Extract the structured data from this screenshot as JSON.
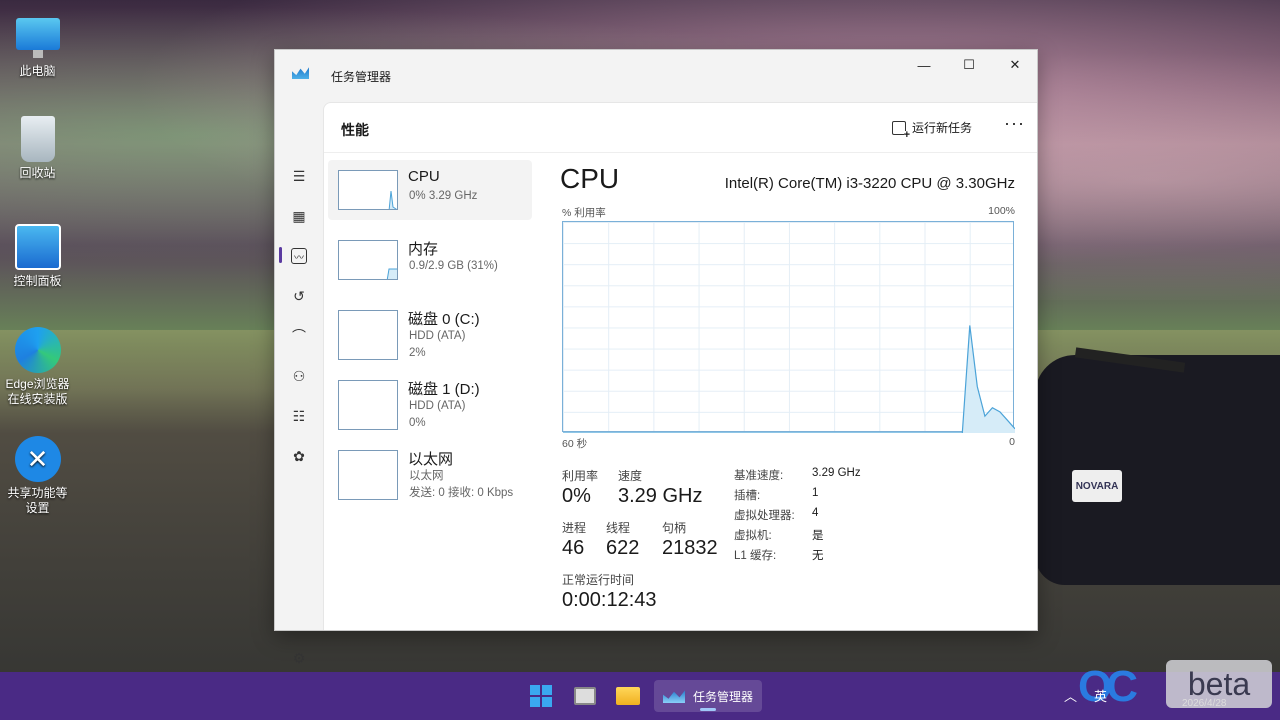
{
  "desktop": {
    "icons": [
      {
        "label": "此电脑"
      },
      {
        "label": "回收站"
      },
      {
        "label": "控制面板"
      },
      {
        "label": "Edge浏览器\n在线安装版",
        "l1": "Edge浏览器",
        "l2": "在线安装版"
      },
      {
        "l1": "共享功能等",
        "l2": "设置"
      }
    ]
  },
  "window": {
    "title": "任务管理器",
    "controls": {
      "minimize": "—",
      "maximize": "☐",
      "close": "✕"
    }
  },
  "header": {
    "title": "性能",
    "run_task": "运行新任务",
    "more": "···"
  },
  "perf_list": [
    {
      "name": "CPU",
      "sub1": "0% 3.29 GHz",
      "sub2": ""
    },
    {
      "name": "内存",
      "sub1": "0.9/2.9 GB (31%)",
      "sub2": ""
    },
    {
      "name": "磁盘 0 (C:)",
      "sub1": "HDD (ATA)",
      "sub2": "2%"
    },
    {
      "name": "磁盘 1 (D:)",
      "sub1": "HDD (ATA)",
      "sub2": "0%"
    },
    {
      "name": "以太网",
      "sub1": "以太网",
      "sub2": "发送: 0 接收: 0 Kbps"
    }
  ],
  "detail": {
    "title": "CPU",
    "model": "Intel(R) Core(TM) i3-3220 CPU @ 3.30GHz",
    "y_label": "% 利用率",
    "y_max": "100%",
    "x_left": "60 秒",
    "x_right": "0",
    "utilization_label": "利用率",
    "utilization": "0%",
    "speed_label": "速度",
    "speed": "3.29 GHz",
    "processes_label": "进程",
    "processes": "46",
    "threads_label": "线程",
    "threads": "622",
    "handles_label": "句柄",
    "handles": "21832",
    "uptime_label": "正常运行时间",
    "uptime": "0:00:12:43",
    "specs": [
      {
        "k": "基准速度:",
        "v": "3.29 GHz"
      },
      {
        "k": "插槽:",
        "v": "1"
      },
      {
        "k": "虚拟处理器:",
        "v": "4"
      },
      {
        "k": "虚拟机:",
        "v": "是"
      },
      {
        "k": "L1 缓存:",
        "v": "无"
      }
    ]
  },
  "chart_data": {
    "type": "area",
    "x": [
      60,
      59,
      58,
      57,
      56,
      55,
      54,
      53,
      52,
      51,
      50,
      49,
      48,
      47,
      46,
      45,
      44,
      43,
      42,
      41,
      40,
      39,
      38,
      37,
      36,
      35,
      34,
      33,
      32,
      31,
      30,
      29,
      28,
      27,
      26,
      25,
      24,
      23,
      22,
      21,
      20,
      19,
      18,
      17,
      16,
      15,
      14,
      13,
      12,
      11,
      10,
      9,
      8,
      7,
      6,
      5,
      4,
      3,
      2,
      1,
      0
    ],
    "values": [
      0,
      0,
      0,
      0,
      0,
      0,
      0,
      0,
      0,
      0,
      0,
      0,
      0,
      0,
      0,
      0,
      0,
      0,
      0,
      0,
      0,
      0,
      0,
      0,
      0,
      0,
      0,
      0,
      0,
      0,
      0,
      0,
      0,
      0,
      0,
      0,
      0,
      0,
      0,
      0,
      0,
      0,
      0,
      0,
      0,
      0,
      0,
      0,
      0,
      0,
      0,
      0,
      0,
      0,
      51,
      22,
      8,
      12,
      10,
      6,
      2
    ],
    "ylim": [
      0,
      100
    ]
  },
  "taskbar": {
    "active_app": "任务管理器",
    "ime": "英",
    "watermark": "beta",
    "oc": "OC",
    "date": "2026/4/28"
  },
  "colors": {
    "accent": "#5a3aa0",
    "graph_stroke": "#4ba3d8",
    "graph_fill": "#d6ecf8",
    "taskbar": "#4a2a85"
  }
}
